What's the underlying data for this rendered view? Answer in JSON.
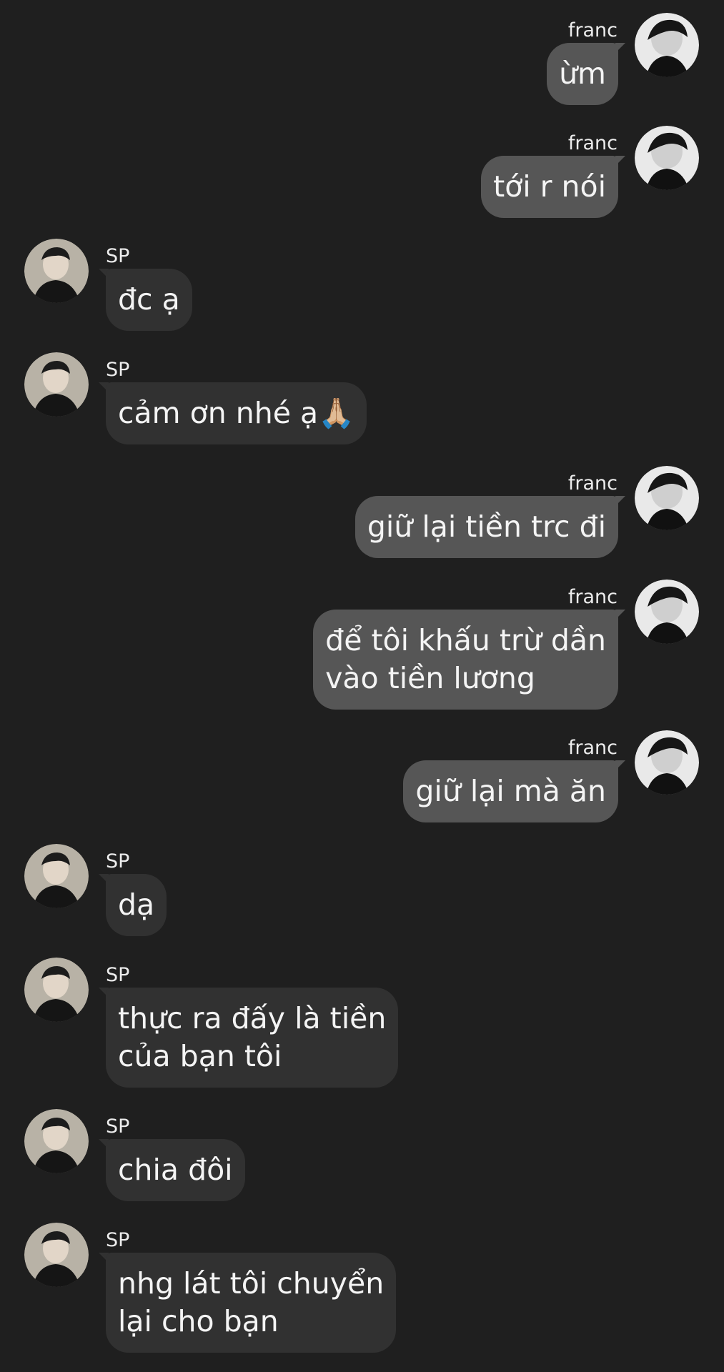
{
  "chat": {
    "messages": [
      {
        "sender": "franc",
        "direction": "out",
        "lines": [
          "ừm"
        ]
      },
      {
        "sender": "franc",
        "direction": "out",
        "lines": [
          "tới r nói"
        ]
      },
      {
        "sender": "SP",
        "direction": "in",
        "lines": [
          "đc ạ"
        ]
      },
      {
        "sender": "SP",
        "direction": "in",
        "lines": [
          "cảm ơn nhé ạ🙏🏼"
        ]
      },
      {
        "sender": "franc",
        "direction": "out",
        "lines": [
          "giữ lại tiền trc đi"
        ]
      },
      {
        "sender": "franc",
        "direction": "out",
        "lines": [
          "để tôi khấu trừ dần",
          "vào tiền lương"
        ]
      },
      {
        "sender": "franc",
        "direction": "out",
        "lines": [
          "giữ lại mà ăn"
        ]
      },
      {
        "sender": "SP",
        "direction": "in",
        "lines": [
          "dạ"
        ]
      },
      {
        "sender": "SP",
        "direction": "in",
        "lines": [
          "thực ra đấy là tiền",
          "của bạn tôi"
        ]
      },
      {
        "sender": "SP",
        "direction": "in",
        "lines": [
          "chia đôi"
        ]
      },
      {
        "sender": "SP",
        "direction": "in",
        "lines": [
          "nhg lát tôi chuyển",
          "lại cho bạn"
        ]
      }
    ]
  },
  "colors": {
    "background": "#1f1f1f",
    "incoming_bubble": "#313131",
    "outgoing_bubble": "#565656",
    "text": "#f4f4f4"
  },
  "icons": {
    "franc_avatar": "franc-avatar-icon",
    "sp_avatar": "sp-avatar-icon"
  }
}
